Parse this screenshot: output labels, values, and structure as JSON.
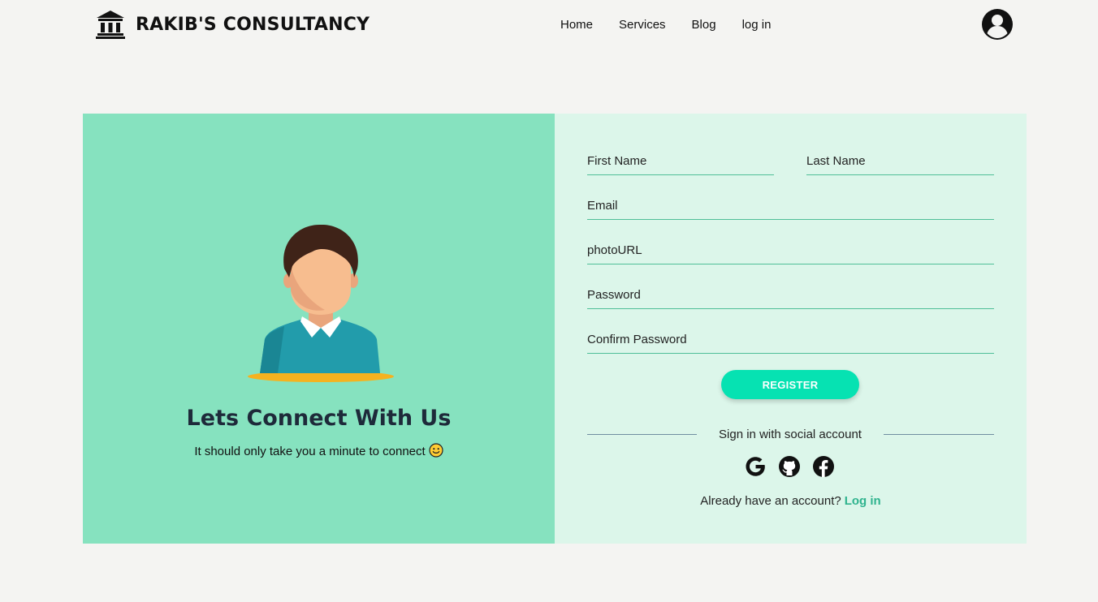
{
  "header": {
    "brand_name": "RAKIB'S CONSULTANCY",
    "brand_icon": "bank-icon",
    "nav": [
      {
        "label": "Home"
      },
      {
        "label": "Services"
      },
      {
        "label": "Blog"
      },
      {
        "label": "log in"
      }
    ],
    "user_icon": "user-circle-icon"
  },
  "left_panel": {
    "title": "Lets Connect With Us",
    "subtitle": "It should only take you a minute to connect",
    "emoji": "smiling-face-icon",
    "background": "#86e2bf"
  },
  "form": {
    "first_name": "First Name",
    "last_name": "Last Name",
    "email": "Email",
    "photo_url": "photoURL",
    "password": "Password",
    "confirm_password": "Confirm Password",
    "register_label": "REGISTER",
    "social_text": "Sign in with social account",
    "social_icons": [
      "google-icon",
      "github-icon",
      "facebook-icon"
    ],
    "have_account_text": "Already have an account?",
    "login_link": "Log in",
    "accent": "#06e2b2",
    "link_color": "#2fb38e",
    "background": "#dcf6ea"
  }
}
